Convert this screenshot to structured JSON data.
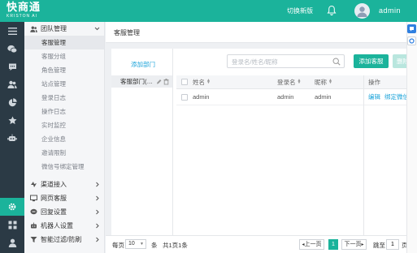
{
  "app": {
    "logo_main": "快商通",
    "logo_sub": "KRISTON AI",
    "switch_version": "切换新版",
    "username": "admin"
  },
  "colors": {
    "brand": "#1bb39b",
    "link": "#1ba3d9",
    "rail": "#2b3a45"
  },
  "rail_icons": [
    "menu-icon",
    "wechat-icon",
    "chat-icon",
    "users-icon",
    "pie-chart-icon",
    "star-icon",
    "robot-icon",
    "gear-icon",
    "grid-icon",
    "person-icon"
  ],
  "menu": {
    "team_group": "团队管理",
    "team_items": [
      "客服管理",
      "客服分组",
      "角色管理",
      "站点管理",
      "登录日志",
      "操作日志",
      "实时监控",
      "企业信息",
      "邀请限制",
      "微信号绑定管理"
    ],
    "groups": [
      "渠道接入",
      "网页客服",
      "回复设置",
      "机器人设置",
      "智能过滤/防刷"
    ]
  },
  "page": {
    "title": "客服管理"
  },
  "dept": {
    "add_label": "添加部门",
    "node_label": "客服部门(…"
  },
  "toolbar": {
    "search_placeholder": "登录名/姓名/昵称",
    "add_label": "添加客服",
    "delete_label": "删除"
  },
  "table": {
    "headers": {
      "name": "姓名",
      "login": "登录名",
      "nick": "昵称",
      "op": "操作"
    },
    "rows": [
      {
        "name": "admin",
        "login": "admin",
        "nick": "admin",
        "op_edit": "编辑",
        "op_bind": "绑定微信"
      }
    ]
  },
  "pager": {
    "per_page_label": "每页",
    "per_page_value": "10",
    "unit": "条",
    "total": "共1页1条",
    "prev": "上一页",
    "current": "1",
    "next": "下一页",
    "jump_label": "跳至",
    "jump_value": "1",
    "page_unit": "页"
  }
}
